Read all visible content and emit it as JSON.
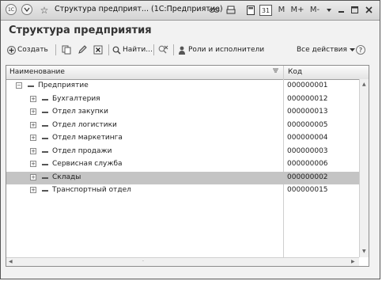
{
  "window": {
    "title": "Структура предприят...  (1С:Предприятие)",
    "buttons": {
      "m": "M",
      "m_plus": "M+",
      "m_minus": "M-",
      "calendar": "31"
    }
  },
  "page": {
    "heading": "Структура предприятия"
  },
  "toolbar": {
    "create_label": "Создать",
    "find_label": "Найти...",
    "roles_label": "Роли и исполнители",
    "all_actions_label": "Все действия",
    "help_label": "?"
  },
  "grid": {
    "columns": {
      "name": "Наименование",
      "code": "Код"
    },
    "rows": [
      {
        "name": "Предприятие",
        "code": "000000001"
      },
      {
        "name": "Бухгалтерия",
        "code": "000000012"
      },
      {
        "name": "Отдел закупки",
        "code": "000000013"
      },
      {
        "name": "Отдел логистики",
        "code": "000000005"
      },
      {
        "name": "Отдел маркетинга",
        "code": "000000004"
      },
      {
        "name": "Отдел продажи",
        "code": "000000003"
      },
      {
        "name": "Сервисная служба",
        "code": "000000006"
      },
      {
        "name": "Склады",
        "code": "000000002",
        "selected": true
      },
      {
        "name": "Транспортный отдел",
        "code": "000000015"
      }
    ]
  },
  "colors": {
    "selection": "#c4c4c4"
  }
}
